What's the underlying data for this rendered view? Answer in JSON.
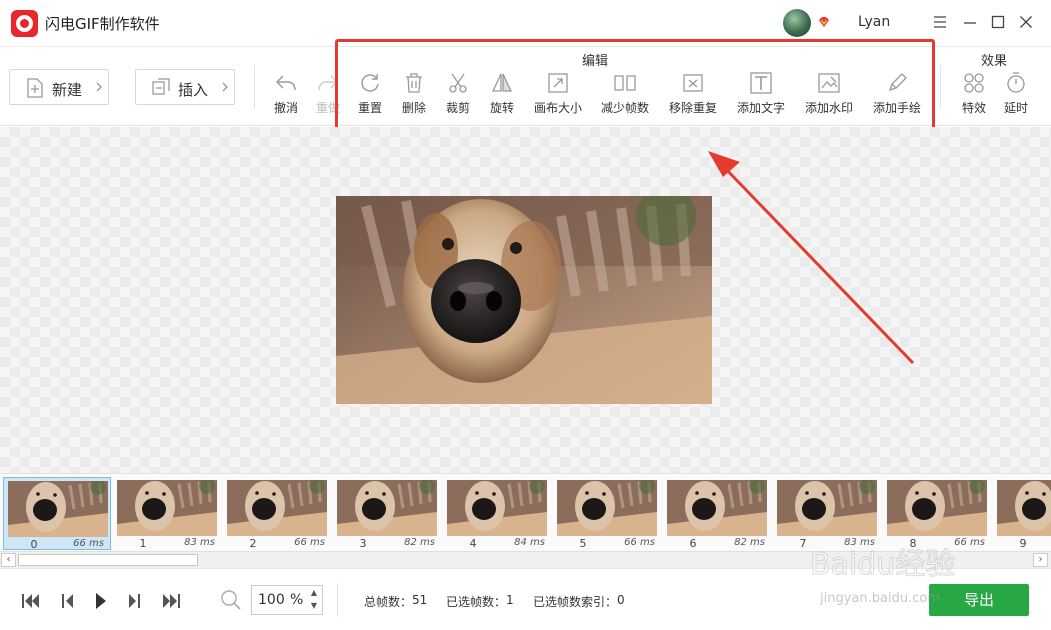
{
  "window": {
    "title": "闪电GIF制作软件",
    "username": "Lyan"
  },
  "toolbar": {
    "new_label": "新建",
    "insert_label": "插入",
    "undo_label": "撤消",
    "redo_label": "重做",
    "edit_group_title": "编辑",
    "edit_tools": [
      "重置",
      "删除",
      "裁剪",
      "旋转",
      "画布大小",
      "减少帧数",
      "移除重复",
      "添加文字",
      "添加水印",
      "添加手绘"
    ],
    "effects_group_title": "效果",
    "effects_tools": [
      "特效",
      "延时"
    ]
  },
  "frames": [
    {
      "index": "0",
      "duration": "66 ms"
    },
    {
      "index": "1",
      "duration": "83 ms"
    },
    {
      "index": "2",
      "duration": "66 ms"
    },
    {
      "index": "3",
      "duration": "82 ms"
    },
    {
      "index": "4",
      "duration": "84 ms"
    },
    {
      "index": "5",
      "duration": "66 ms"
    },
    {
      "index": "6",
      "duration": "82 ms"
    },
    {
      "index": "7",
      "duration": "83 ms"
    },
    {
      "index": "8",
      "duration": "66 ms"
    },
    {
      "index": "9",
      "duration": ""
    }
  ],
  "selected_frame": "0",
  "zoom": {
    "value": "100",
    "unit": "%"
  },
  "status": {
    "total_frames_label": "总帧数：",
    "total_frames": "51",
    "selected_count_label": "已选帧数：",
    "selected_count": "1",
    "selected_index_label": "已选帧数索引：",
    "selected_index": "0"
  },
  "export_label": "导出",
  "watermark": {
    "brand": "Baidu经验",
    "url": "jingyan.baidu.com"
  },
  "colors": {
    "accent_red": "#e53b2f",
    "export_green": "#27a844",
    "logo_red": "#e8262b",
    "selected_frame": "#cfe6f7"
  }
}
